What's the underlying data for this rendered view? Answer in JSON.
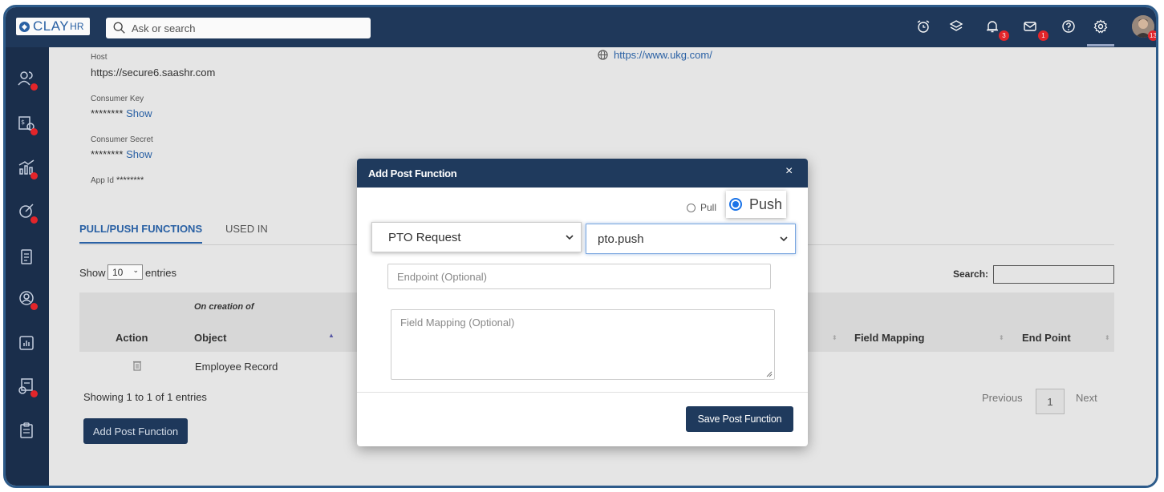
{
  "brand": {
    "logo_text": "CLAY",
    "logo_suffix": "HR"
  },
  "search": {
    "placeholder": "Ask or search"
  },
  "header": {
    "notifications_count": "3",
    "messages_count": "1",
    "avatar_badge": "13"
  },
  "details": {
    "host_label": "Host",
    "host_value": "https://secure6.saashr.com",
    "consumer_key_label": "Consumer Key",
    "consumer_key_value": "********",
    "consumer_key_show": "Show",
    "consumer_secret_label": "Consumer Secret",
    "consumer_secret_value": "********",
    "consumer_secret_show": "Show",
    "app_id_label": "App Id",
    "app_id_value": "********",
    "website": "https://www.ukg.com/"
  },
  "tabs": {
    "active": "PULL/PUSH FUNCTIONS",
    "other": "USED IN"
  },
  "table": {
    "show_label": "Show",
    "page_size": "10",
    "entries_label": "entries",
    "search_label": "Search:",
    "group_header": "On creation of",
    "columns": {
      "action": "Action",
      "object": "Object",
      "field_mapping": "Field Mapping",
      "end_point": "End Point"
    },
    "rows": [
      {
        "object": "Employee Record"
      }
    ],
    "info": "Showing 1 to 1 of 1 entries",
    "prev": "Previous",
    "page": "1",
    "next": "Next"
  },
  "add_button": "Add Post Function",
  "modal": {
    "title": "Add Post Function",
    "close": "×",
    "pull_label": "Pull",
    "push_label": "Push",
    "selected_mode": "Push",
    "select_one": "PTO Request",
    "select_two": "pto.push",
    "endpoint_placeholder": "Endpoint (Optional)",
    "mapping_placeholder": "Field Mapping (Optional)",
    "save_button": "Save Post Function"
  },
  "colors": {
    "header_bg": "#203a5c",
    "sidebar_bg": "#1b2f4d",
    "accent": "#2b63a8",
    "badge": "#e8262b",
    "button": "#1f3a5d"
  }
}
